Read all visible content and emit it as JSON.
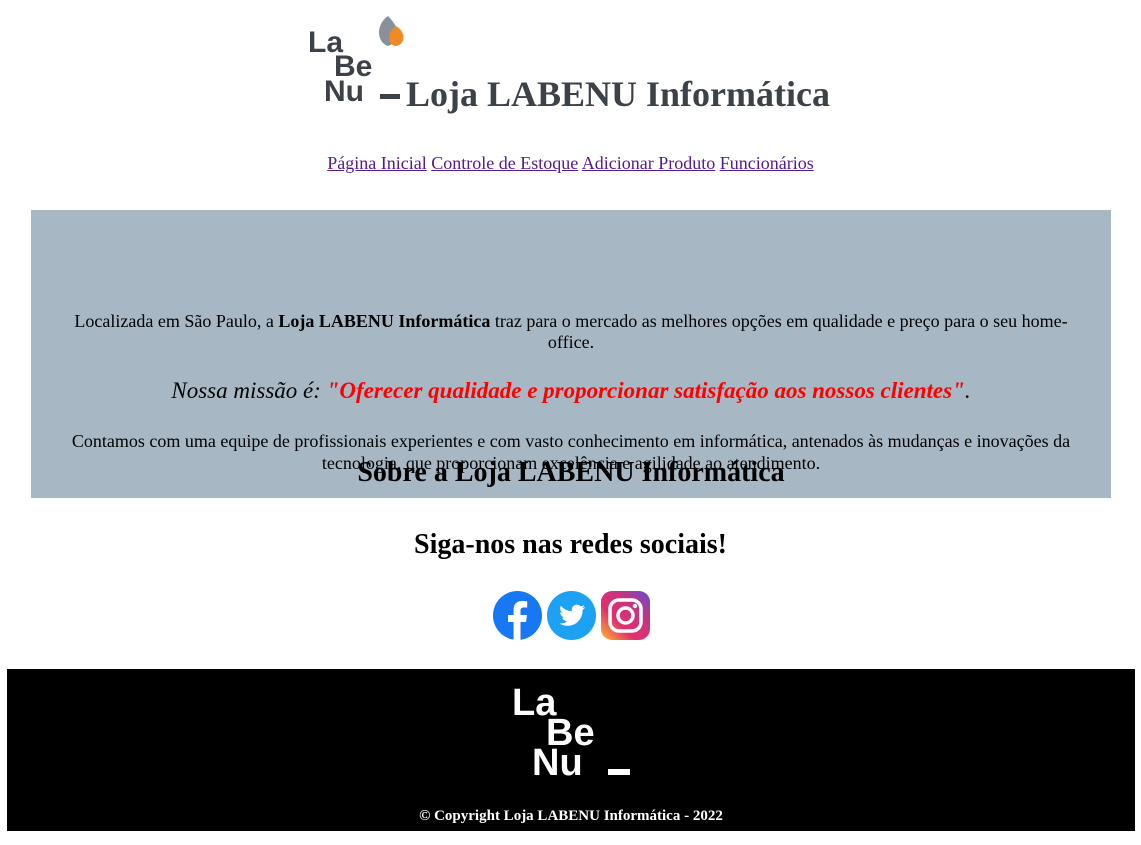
{
  "header": {
    "logo_text": "LaBeNu_",
    "title": "Loja LABENU Informática"
  },
  "nav": {
    "items": [
      {
        "label": "Página Inicial"
      },
      {
        "label": "Controle de Estoque"
      },
      {
        "label": "Adicionar Produto"
      },
      {
        "label": "Funcionários"
      }
    ]
  },
  "about": {
    "title": "Sobre a Loja LABENU Informática",
    "p1_before": "Localizada em São Paulo, a ",
    "p1_bold": "Loja LABENU Informática",
    "p1_after": " traz para o mercado as melhores opções em qualidade e preço para o seu home-office.",
    "mission_prefix": "Nossa missão é: ",
    "mission_quote": "\"Oferecer qualidade e proporcionar satisfação aos nossos clientes\"",
    "mission_suffix": ".",
    "p2": "Contamos com uma equipe de profissionais experientes e com vasto conhecimento em informática, antenados às mudanças e inovações da tecnologia, que proporcionam excelência e agilidade ao atendimento."
  },
  "social": {
    "title": "Siga-nos nas redes sociais!",
    "icons": [
      "facebook-icon",
      "twitter-icon",
      "instagram-icon"
    ]
  },
  "footer": {
    "logo_text": "LaBeNu_",
    "copyright": "© Copyright Loja LABENU Informática - 2022"
  },
  "colors": {
    "title": "#3d4249",
    "about_bg": "#a7b8c4",
    "mission_quote": "#ff0000",
    "link": "#551a8b",
    "footer_bg": "#000000",
    "logo_orange": "#f08a24",
    "logo_gray": "#8a9099"
  }
}
